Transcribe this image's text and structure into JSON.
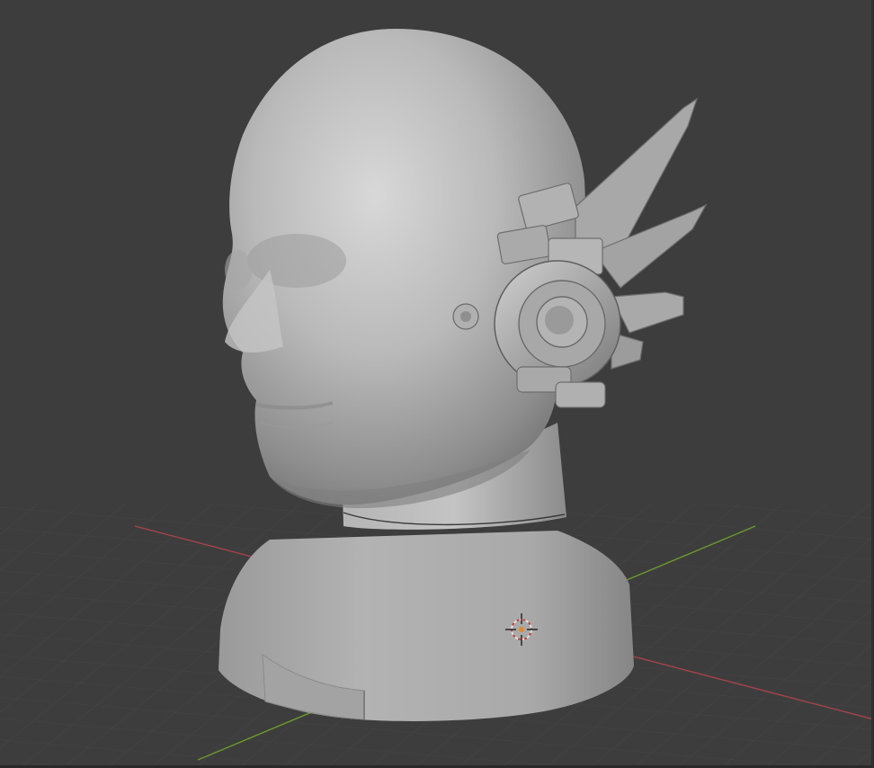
{
  "viewport": {
    "kind": "3d-viewport",
    "background_color": "#3d3d3d",
    "grid_color": "#4a4a4a",
    "x_axis_color": "#a8434c",
    "y_axis_color": "#6c9a2e",
    "model_base_color": "#b4b4b4"
  },
  "scene": {
    "object": "sculpted-head-bust",
    "accessory": "mechanical-ear-piece",
    "cursor": "3d-cursor-icon"
  }
}
